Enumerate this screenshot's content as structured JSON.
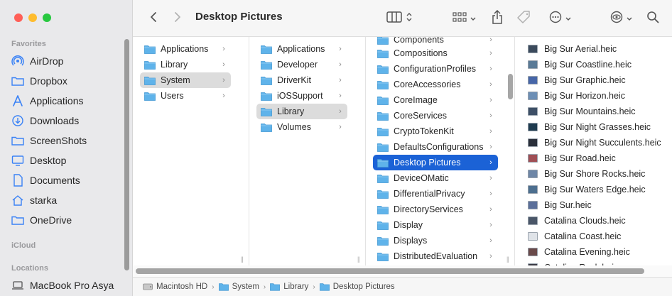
{
  "toolbar": {
    "title": "Desktop Pictures"
  },
  "sidebar": {
    "favorites_label": "Favorites",
    "icloud_label": "iCloud",
    "locations_label": "Locations",
    "favorites": [
      {
        "label": "AirDrop",
        "icon": "airdrop-icon"
      },
      {
        "label": "Dropbox",
        "icon": "folder-icon"
      },
      {
        "label": "Applications",
        "icon": "applications-icon"
      },
      {
        "label": "Downloads",
        "icon": "download-icon"
      },
      {
        "label": "ScreenShots",
        "icon": "folder-icon"
      },
      {
        "label": "Desktop",
        "icon": "desktop-icon"
      },
      {
        "label": "Documents",
        "icon": "document-icon"
      },
      {
        "label": "starka",
        "icon": "home-icon"
      },
      {
        "label": "OneDrive",
        "icon": "folder-icon"
      }
    ],
    "locations": [
      {
        "label": "MacBook Pro Asya",
        "icon": "laptop-icon"
      }
    ]
  },
  "columns": {
    "col1": [
      "Applications",
      "Library",
      "System",
      "Users"
    ],
    "col1_selected": "System",
    "col2": [
      "Applications",
      "Developer",
      "DriverKit",
      "iOSSupport",
      "Library",
      "Volumes"
    ],
    "col2_selected": "Library",
    "col3": [
      "Components",
      "Compositions",
      "ConfigurationProfiles",
      "CoreAccessories",
      "CoreImage",
      "CoreServices",
      "CryptoTokenKit",
      "DefaultsConfigurations",
      "Desktop Pictures",
      "DeviceOMatic",
      "DifferentialPrivacy",
      "DirectoryServices",
      "Display",
      "Displays",
      "DistributedEvaluation"
    ],
    "col3_selected": "Desktop Pictures",
    "col4": [
      {
        "label": "Big Sur Aerial.heic",
        "color": "#3b4a5c"
      },
      {
        "label": "Big Sur Coastline.heic",
        "color": "#5a7a96"
      },
      {
        "label": "Big Sur Graphic.heic",
        "color": "#4766a8"
      },
      {
        "label": "Big Sur Horizon.heic",
        "color": "#6d8fb5"
      },
      {
        "label": "Big Sur Mountains.heic",
        "color": "#3d4f66"
      },
      {
        "label": "Big Sur Night Grasses.heic",
        "color": "#1f3b4f"
      },
      {
        "label": "Big Sur Night Succulents.heic",
        "color": "#2a2f3a"
      },
      {
        "label": "Big Sur Road.heic",
        "color": "#a04f55"
      },
      {
        "label": "Big Sur Shore Rocks.heic",
        "color": "#6e86a6"
      },
      {
        "label": "Big Sur Waters Edge.heic",
        "color": "#4d6f8f"
      },
      {
        "label": "Big Sur.heic",
        "color": "#5b6f9a"
      },
      {
        "label": "Catalina Clouds.heic",
        "color": "#4a5668"
      },
      {
        "label": "Catalina Coast.heic",
        "color": "#dfe3e8"
      },
      {
        "label": "Catalina Evening.heic",
        "color": "#6a4a4a"
      },
      {
        "label": "Catalina Rock.heic",
        "color": "#3a3a44"
      }
    ]
  },
  "pathbar": [
    {
      "label": "Macintosh HD",
      "icon": "drive-icon"
    },
    {
      "label": "System",
      "icon": "folder-icon"
    },
    {
      "label": "Library",
      "icon": "folder-icon"
    },
    {
      "label": "Desktop Pictures",
      "icon": "folder-icon"
    }
  ]
}
